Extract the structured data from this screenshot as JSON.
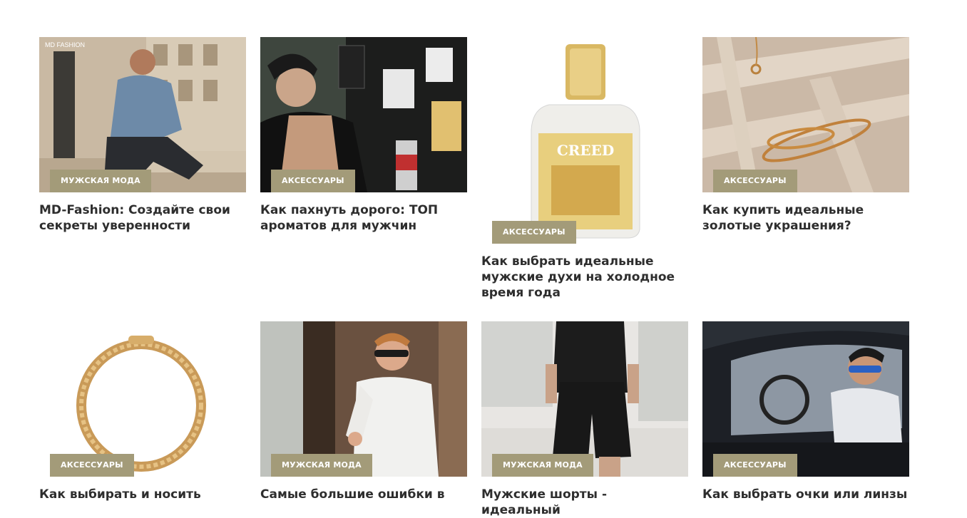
{
  "cards": [
    {
      "category": "МУЖСКАЯ МОДА",
      "title": "MD-Fashion: Создайте свои секреты уверенности",
      "watermark": "MD FASHION"
    },
    {
      "category": "АКСЕССУАРЫ",
      "title": "Как пахнуть дорого: ТОП ароматов для мужчин"
    },
    {
      "category": "АКСЕССУАРЫ",
      "title": "Как выбрать идеальные мужские духи на холодное время года",
      "bottle_label": "CREED"
    },
    {
      "category": "АКСЕССУАРЫ",
      "title": "Как купить идеальные золотые украшения?"
    },
    {
      "category": "АКСЕССУАРЫ",
      "title": "Как выбирать и носить"
    },
    {
      "category": "МУЖСКАЯ МОДА",
      "title": "Самые большие ошибки в"
    },
    {
      "category": "МУЖСКАЯ МОДА",
      "title": "Мужские шорты - идеальный"
    },
    {
      "category": "АКСЕССУАРЫ",
      "title": "Как выбрать очки или линзы"
    }
  ],
  "colors": {
    "badge": "#a39b79",
    "title": "#2e2e2e"
  }
}
